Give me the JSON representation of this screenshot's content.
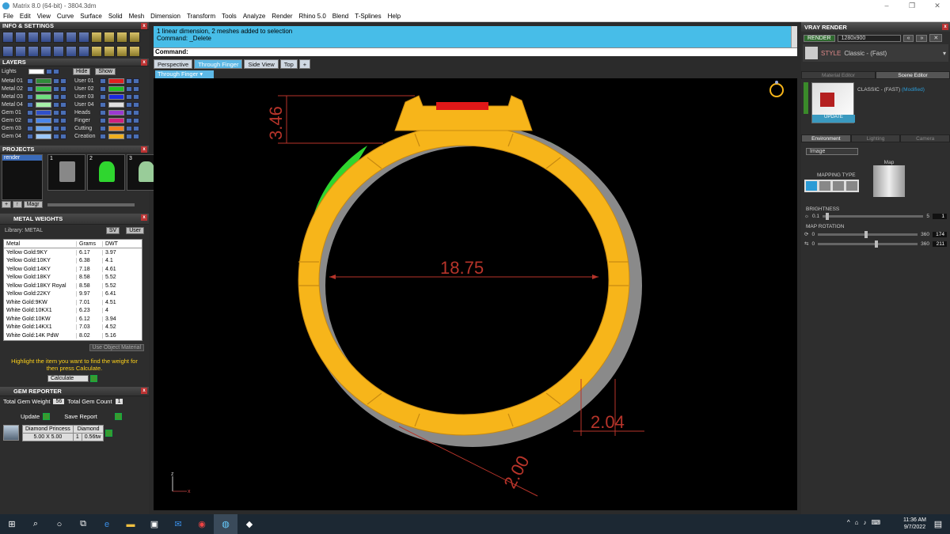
{
  "window": {
    "title": "Matrix 8.0 (64-bit) - 3804.3dm",
    "min": "–",
    "max": "❐",
    "close": "✕"
  },
  "menu": [
    "File",
    "Edit",
    "View",
    "Curve",
    "Surface",
    "Solid",
    "Mesh",
    "Dimension",
    "Transform",
    "Tools",
    "Analyze",
    "Render",
    "Rhino 5.0",
    "Blend",
    "T-Splines",
    "Help"
  ],
  "left": {
    "info_title": "INFO & SETTINGS",
    "layers_title": "LAYERS",
    "lights_label": "Lights",
    "hide_label": "Hide",
    "show_label": "Show",
    "layers_left": [
      {
        "name": "Metal 01",
        "color": "#2f8a3a"
      },
      {
        "name": "Metal 02",
        "color": "#38c24a"
      },
      {
        "name": "Metal 03",
        "color": "#6fe07f"
      },
      {
        "name": "Metal 04",
        "color": "#a6f0a8"
      },
      {
        "name": "Gem 01",
        "color": "#3050c8"
      },
      {
        "name": "Gem 02",
        "color": "#4a86ea"
      },
      {
        "name": "Gem 03",
        "color": "#6aa6f2"
      },
      {
        "name": "Gem 04",
        "color": "#9dc8fa"
      }
    ],
    "layers_right": [
      {
        "name": "User 01",
        "color": "#e02020"
      },
      {
        "name": "User 02",
        "color": "#22c022"
      },
      {
        "name": "User 03",
        "color": "#1a2ae0"
      },
      {
        "name": "User 04",
        "color": "#e0e0e0"
      },
      {
        "name": "Heads",
        "color": "#9a3ad0"
      },
      {
        "name": "Finger",
        "color": "#d02080"
      },
      {
        "name": "Cutting",
        "color": "#f08020"
      },
      {
        "name": "Creation",
        "color": "#f0b020"
      }
    ],
    "projects_title": "PROJECTS",
    "project_name": "render",
    "thumbs": [
      "1",
      "2",
      "3"
    ],
    "magr_label": "Magr",
    "metal_title": "METAL WEIGHTS",
    "library_label": "Library: METAL",
    "sv_label": "SV",
    "user_label": "User",
    "table_headers": [
      "Metal",
      "Grams",
      "DWT"
    ],
    "metals": [
      [
        "Yellow Gold:9KY",
        "6.17",
        "3.97"
      ],
      [
        "Yellow Gold:10KY",
        "6.38",
        "4.1"
      ],
      [
        "Yellow Gold:14KY",
        "7.18",
        "4.61"
      ],
      [
        "Yellow Gold:18KY",
        "8.58",
        "5.52"
      ],
      [
        "Yellow Gold:18KY Royal",
        "8.58",
        "5.52"
      ],
      [
        "Yellow Gold:22KY",
        "9.97",
        "6.41"
      ],
      [
        "White Gold:9KW",
        "7.01",
        "4.51"
      ],
      [
        "White Gold:10KX1",
        "6.23",
        "4"
      ],
      [
        "White Gold:10KW",
        "6.12",
        "3.94"
      ],
      [
        "White Gold:14KX1",
        "7.03",
        "4.52"
      ],
      [
        "White Gold:14K PdW",
        "8.02",
        "5.16"
      ]
    ],
    "use_object_material": "Use Object Material",
    "hint": "Highlight the item you want to find the weight for then press Calculate.",
    "calculate": "Calculate",
    "gem_title": "GEM REPORTER",
    "total_gem_weight_label": "Total Gem Weight",
    "total_gem_weight": "56",
    "total_gem_count_label": "Total Gem Count",
    "total_gem_count": "1",
    "update_label": "Update",
    "save_report_label": "Save Report",
    "gem_cells": [
      [
        "Diamond Princess",
        "Diamond"
      ],
      [
        "5.00 X 5.00",
        "1",
        "0.56tw"
      ]
    ]
  },
  "command": {
    "history1": "1 linear dimension, 2 meshes added to selection",
    "history2": "Command: _Delete",
    "prompt": "Command:"
  },
  "viewtabs": [
    {
      "label": "Perspective",
      "active": false
    },
    {
      "label": "Through Finger",
      "active": true
    },
    {
      "label": "Side View",
      "active": false
    },
    {
      "label": "Top",
      "active": false
    },
    {
      "label": "+",
      "active": false
    }
  ],
  "viewport_label": "Through Finger",
  "dims": {
    "top": "3.46",
    "width": "18.75",
    "right": "2.04",
    "bottom": "2.00"
  },
  "axis": {
    "z": "z",
    "x": "x"
  },
  "right": {
    "title": "VRAY RENDER",
    "render_btn": "RENDER",
    "resolution": "1280x900",
    "style_label": "STYLE",
    "style_value": "Classic - (Fast)",
    "tab_material": "Material Editor",
    "tab_scene": "Scene Editor",
    "material_name": "CLASSIC - (FAST)",
    "material_state": "(Modified)",
    "update": "UPDATE",
    "env_tabs": [
      "Environment",
      "Lighting",
      "Camera"
    ],
    "image_select": "Image",
    "mapping_type": "MAPPING TYPE",
    "map_label": "Map",
    "brightness_label": "BRIGHTNESS",
    "brightness": {
      "min": "0.1",
      "max": "5",
      "value": "1",
      "level": 0.05
    },
    "map_rotation_label": "MAP ROTATION",
    "rot1": {
      "min": "0",
      "max": "360",
      "value": "174",
      "level": 0.483
    },
    "rot2": {
      "min": "0",
      "max": "360",
      "value": "211",
      "level": 0.586
    }
  },
  "taskbar": {
    "time": "11:36 AM",
    "date": "9/7/2022"
  },
  "colors": {
    "gold": "#f7b51a",
    "green": "#2fd62f",
    "dim": "#b7342a",
    "cmd": "#47bde8"
  }
}
